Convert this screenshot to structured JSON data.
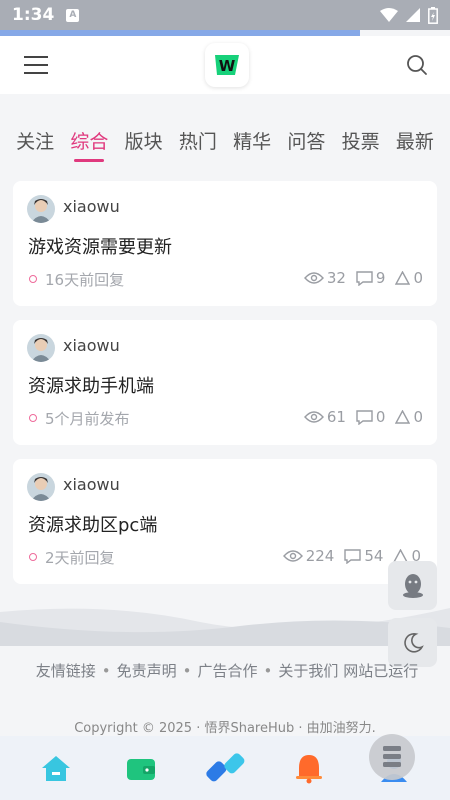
{
  "status_bar": {
    "time": "1:34",
    "notif_letter": "A"
  },
  "header": {
    "menu_icon": "hamburger-menu-icon",
    "logo_letter": "W",
    "search_icon": "search-icon"
  },
  "tabs": [
    {
      "label": "关注",
      "active": false
    },
    {
      "label": "综合",
      "active": true
    },
    {
      "label": "版块",
      "active": false
    },
    {
      "label": "热门",
      "active": false
    },
    {
      "label": "精华",
      "active": false
    },
    {
      "label": "问答",
      "active": false
    },
    {
      "label": "投票",
      "active": false
    },
    {
      "label": "最新",
      "active": false
    }
  ],
  "accent_color": "#e0397e",
  "posts": [
    {
      "author": "xiaowu",
      "title": "游戏资源需要更新",
      "time": "16天前回复",
      "views": "32",
      "comments": "9",
      "likes": "0"
    },
    {
      "author": "xiaowu",
      "title": "资源求助手机端",
      "time": "5个月前发布",
      "views": "61",
      "comments": "0",
      "likes": "0"
    },
    {
      "author": "xiaowu",
      "title": "资源求助区pc端",
      "time": "2天前回复",
      "views": "224",
      "comments": "54",
      "likes": "0"
    }
  ],
  "footer": {
    "links": [
      "友情链接",
      "免责声明",
      "广告合作",
      "关于我们"
    ],
    "extra": "网站已运行",
    "copyright": "Copyright © 2025 · 悟界ShareHub · 由加油努力."
  },
  "float_buttons": [
    "qq-icon",
    "moon-icon"
  ],
  "bottom_nav": [
    "home-icon",
    "wallet-icon",
    "link-icon",
    "bell-icon",
    "user-icon"
  ]
}
